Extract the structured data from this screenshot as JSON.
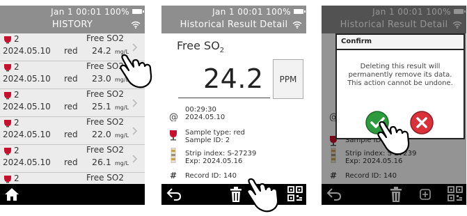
{
  "status": {
    "date": "Jan",
    "day": "1",
    "time": "00:01",
    "battery": "100%"
  },
  "screen1": {
    "title": "HISTORY",
    "rows": [
      {
        "sample_id": "2",
        "param": "Free SO2",
        "date": "2024.05.10",
        "sample_type": "red",
        "value": "24.2",
        "unit": "mg/L"
      },
      {
        "sample_id": "2",
        "param": "Free SO2",
        "date": "2024.05.10",
        "sample_type": "red",
        "value": "23.0",
        "unit": "mg/L"
      },
      {
        "sample_id": "2",
        "param": "Free SO2",
        "date": "2024.05.10",
        "sample_type": "red",
        "value": "25.1",
        "unit": "mg/L"
      },
      {
        "sample_id": "2",
        "param": "Free SO2",
        "date": "2024.05.10",
        "sample_type": "red",
        "value": "22.0",
        "unit": "mg/L"
      },
      {
        "sample_id": "2",
        "param": "Free SO2",
        "date": "2024.05.10",
        "sample_type": "red",
        "value": "26.1",
        "unit": "mg/L"
      },
      {
        "sample_id": "2",
        "param": "Free SO2",
        "date": "",
        "sample_type": "",
        "value": "",
        "unit": ""
      }
    ]
  },
  "screen2": {
    "title": "Historical Result Detail",
    "param_main": "Free SO",
    "param_sub": "2",
    "value": "24.2",
    "unit": "PPM",
    "time": "00:29:30",
    "date": "2024.05.10",
    "sample_type": "Sample type: red",
    "sample_id": "Sample ID: 2",
    "strip_index": "Strip index: S-27239",
    "exp": "Exp: 2024.05.16",
    "record_id": "Record ID: 140"
  },
  "screen3": {
    "title": "Historical Result Detail",
    "dialog_title": "Confirm",
    "msg1": "Deleting this result will",
    "msg2": "permanently remove its data.",
    "msg3": "This action cannot be undone.",
    "bg_sample_id": "Sample ID",
    "strip_index": "Strip index: S-27239",
    "exp": "Exp: 2024.05.16",
    "record_id": "Record ID: 140"
  },
  "colors": {
    "header": "#8e8e8e",
    "confirm_green": "#2e9a3e",
    "cancel_red": "#d9303a",
    "wine_red": "#c8102e"
  },
  "icons": [
    "home-icon",
    "back-icon",
    "trash-icon",
    "add-icon",
    "qr-code-icon",
    "wifi-icon",
    "battery-icon",
    "wine-glass-icon",
    "test-strip-icon",
    "clock-icon",
    "hash-icon",
    "chevron-right-icon",
    "tap-hand-icon",
    "check-icon",
    "close-icon"
  ]
}
